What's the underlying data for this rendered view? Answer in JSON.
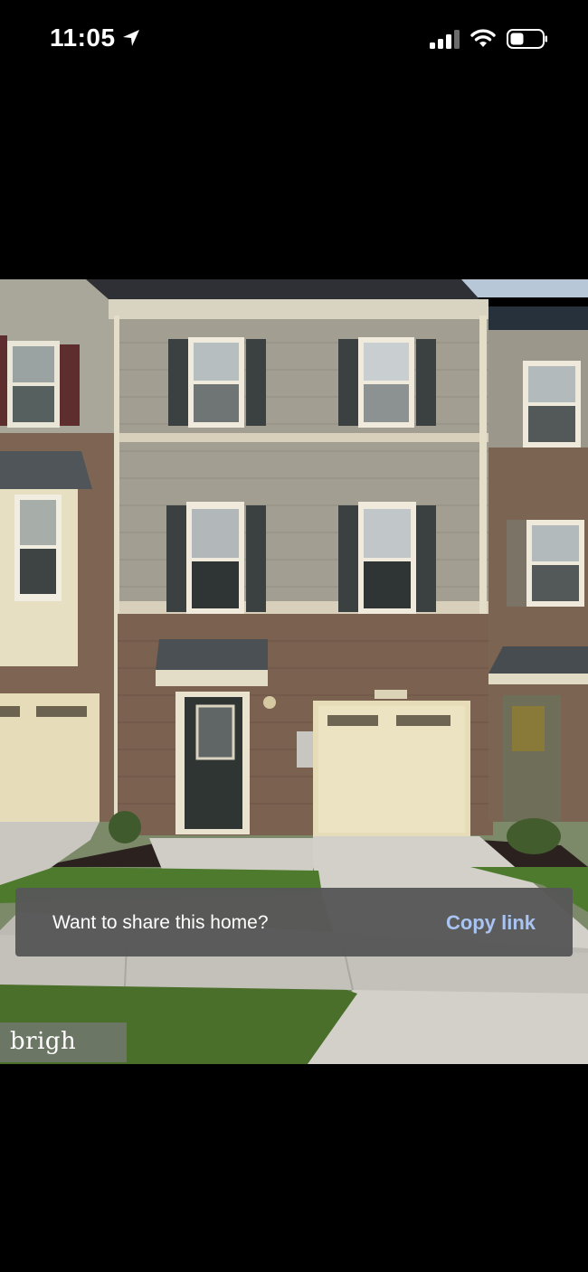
{
  "status_bar": {
    "time": "11:05",
    "icons": [
      "location-arrow-icon",
      "cellular-signal-icon",
      "wifi-icon",
      "battery-icon"
    ]
  },
  "photo": {
    "watermark_text": "brigh"
  },
  "share_toast": {
    "message": "Want to share this home?",
    "action_label": "Copy link",
    "action_color": "#a9c4f2"
  }
}
